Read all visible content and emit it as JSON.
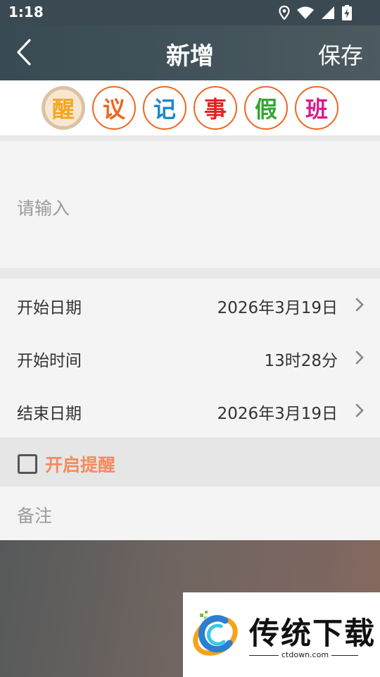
{
  "status_bar": {
    "time": "1:18"
  },
  "header": {
    "title": "新增",
    "save_label": "保存"
  },
  "types": [
    {
      "label": "醒",
      "color": "#f5a623",
      "selected": true
    },
    {
      "label": "议",
      "color": "#f0661f",
      "selected": false
    },
    {
      "label": "记",
      "color": "#1e88c8",
      "selected": false
    },
    {
      "label": "事",
      "color": "#e0241d",
      "selected": false
    },
    {
      "label": "假",
      "color": "#33a531",
      "selected": false
    },
    {
      "label": "班",
      "color": "#d81b8c",
      "selected": false
    }
  ],
  "content_input": {
    "placeholder": "请输入"
  },
  "fields": {
    "start_date": {
      "label": "开始日期",
      "value": "2026年3月19日"
    },
    "start_time": {
      "label": "开始时间",
      "value": "13时28分"
    },
    "end_date": {
      "label": "结束日期",
      "value": "2026年3月19日"
    }
  },
  "reminder": {
    "label": "开启提醒",
    "checked": false
  },
  "notes": {
    "placeholder": "备注"
  },
  "watermark": {
    "name": "传统下载",
    "url": "ctdown.com"
  }
}
